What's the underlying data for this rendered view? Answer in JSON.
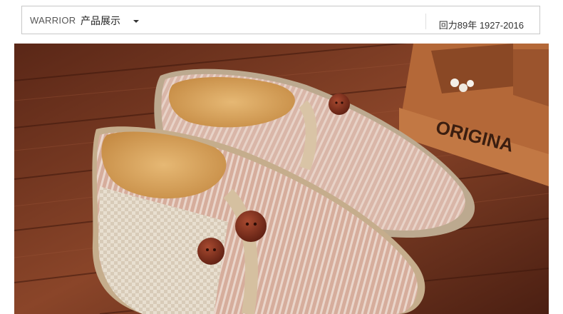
{
  "header": {
    "brand": "WARRIOR",
    "menu_label": "产品展示",
    "history_text": "回力89年 1927-2016"
  },
  "hero": {
    "box_text": "ORIGINA",
    "colors": {
      "wood": "#7a3a24",
      "fabric": "#d7b2a4",
      "fleece": "#d9a765",
      "button": "#7b2f1f",
      "box": "#b86b3a"
    }
  }
}
